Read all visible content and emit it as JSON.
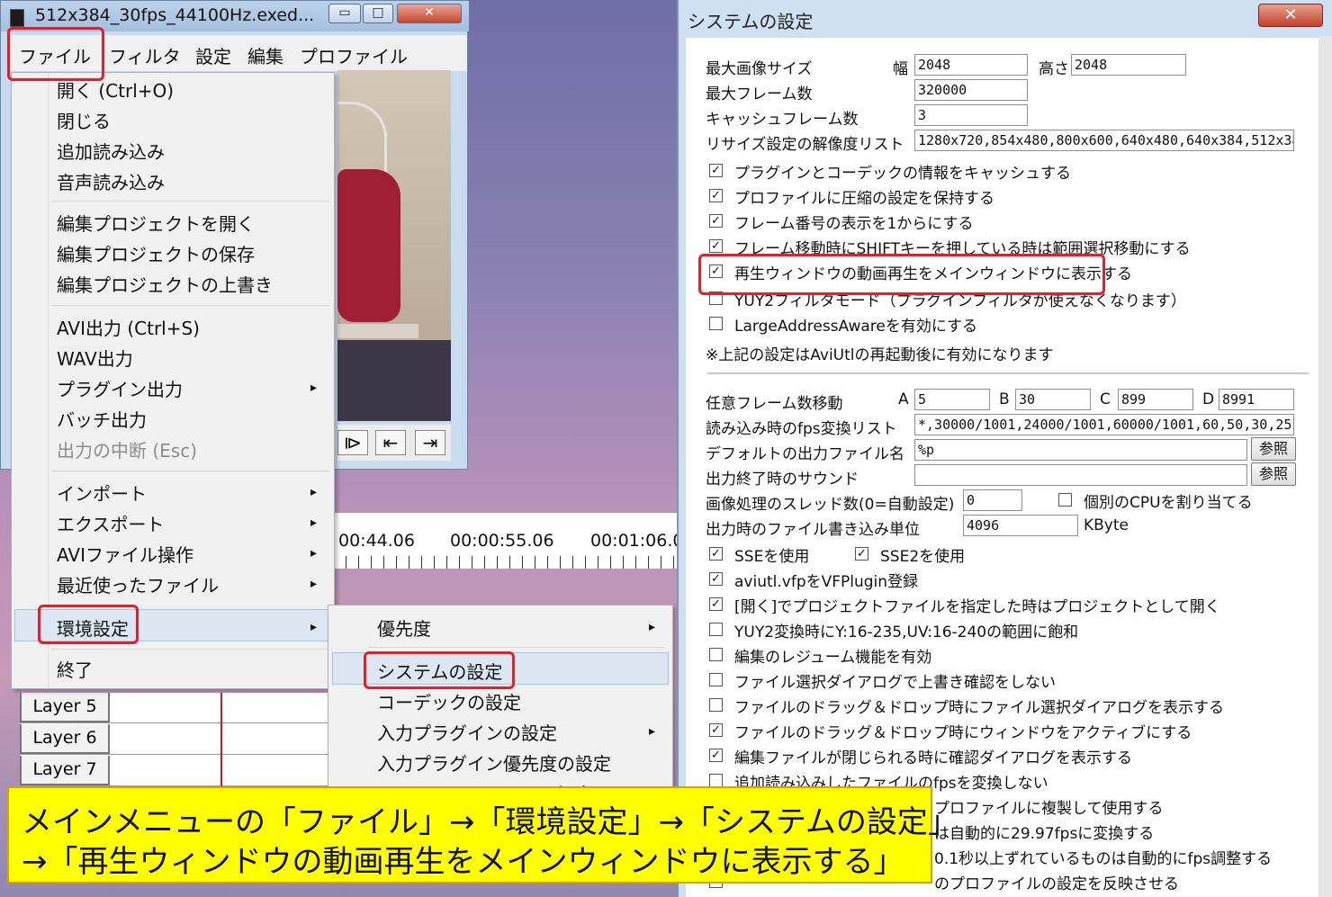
{
  "main_window": {
    "title": "512x384_30fps_44100Hz.exed...",
    "buttons": {
      "minimize": "▭",
      "maximize": "□",
      "close": "✕"
    },
    "menubar": [
      "ファイル",
      "フィルタ",
      "設定",
      "編集",
      "プロファイル"
    ],
    "transport": [
      "⧐",
      "⇤",
      "⇥"
    ],
    "timeline": {
      "times": [
        "00:44.06",
        "00:00:55.06",
        "00:01:06.0"
      ]
    },
    "layers": [
      "Layer  5",
      "Layer  6",
      "Layer  7"
    ]
  },
  "file_menu": {
    "items": [
      {
        "label": "開く (Ctrl+O)"
      },
      {
        "label": "閉じる"
      },
      {
        "label": "追加読み込み"
      },
      {
        "label": "音声読み込み"
      },
      {
        "label": "編集プロジェクトを開く"
      },
      {
        "label": "編集プロジェクトの保存"
      },
      {
        "label": "編集プロジェクトの上書き"
      },
      {
        "label": "AVI出力 (Ctrl+S)"
      },
      {
        "label": "WAV出力"
      },
      {
        "label": "プラグイン出力",
        "submenu": true
      },
      {
        "label": "バッチ出力"
      },
      {
        "label": "出力の中断 (Esc)",
        "disabled": true
      },
      {
        "label": "インポート",
        "submenu": true
      },
      {
        "label": "エクスポート",
        "submenu": true
      },
      {
        "label": "AVIファイル操作",
        "submenu": true
      },
      {
        "label": "最近使ったファイル",
        "submenu": true
      },
      {
        "label": "環境設定",
        "submenu": true,
        "highlighted": true
      },
      {
        "label": "終了"
      }
    ],
    "arrow_glyph": "▸"
  },
  "env_submenu": {
    "items": [
      {
        "label": "優先度",
        "submenu": true
      },
      {
        "label": "システムの設定",
        "highlighted": true
      },
      {
        "label": "コーデックの設定"
      },
      {
        "label": "入力プラグインの設定",
        "submenu": true
      },
      {
        "label": "入力プラグイン優先度の設定"
      },
      {
        "label": "ショートカットキーの設定"
      }
    ]
  },
  "dialog": {
    "title": "システムの設定",
    "close": "✕",
    "max_image_size": {
      "label": "最大画像サイズ",
      "width_label": "幅",
      "width": "2048",
      "height_label": "高さ",
      "height": "2048"
    },
    "max_frames": {
      "label": "最大フレーム数",
      "value": "320000"
    },
    "cache_frames": {
      "label": "キャッシュフレーム数",
      "value": "3"
    },
    "resize_list": {
      "label": "リサイズ設定の解像度リスト",
      "value": "1280x720,854x480,800x600,640x480,640x384,512x384"
    },
    "checks_top": [
      {
        "label": "プラグインとコーデックの情報をキャッシュする",
        "checked": true
      },
      {
        "label": "プロファイルに圧縮の設定を保持する",
        "checked": true
      },
      {
        "label": "フレーム番号の表示を1からにする",
        "checked": true
      },
      {
        "label": "フレーム移動時にSHIFTキーを押している時は範囲選択移動にする",
        "checked": true
      },
      {
        "label": "再生ウィンドウの動画再生をメインウィンドウに表示する",
        "checked": true
      },
      {
        "label": "YUY2フィルタモード（プラグインフィルタが使えなくなります）",
        "checked": false
      },
      {
        "label": "LargeAddressAwareを有効にする",
        "checked": false
      }
    ],
    "restart_note": "※上記の設定はAviUtlの再起動後に有効になります",
    "frame_jump": {
      "label": "任意フレーム数移動",
      "A": "5",
      "B": "30",
      "C": "899",
      "D": "8991"
    },
    "fps_list": {
      "label": "読み込み時のfps変換リスト",
      "value": "*,30000/1001,24000/1001,60000/1001,60,50,30,25,24,:"
    },
    "default_output": {
      "label": "デフォルトの出力ファイル名",
      "value": "%p",
      "ref": "参照"
    },
    "output_sound": {
      "label": "出力終了時のサウンド",
      "value": "",
      "ref": "参照"
    },
    "threads": {
      "label": "画像処理のスレッド数(0=自動設定)",
      "value": "0",
      "cpu_label": "個別のCPUを割り当てる"
    },
    "write_unit": {
      "label": "出力時のファイル書き込み単位",
      "value": "4096",
      "unit": "KByte"
    },
    "sse": {
      "label": "SSEを使用",
      "sse2": "SSE2を使用"
    },
    "checks_bottom": [
      {
        "label": "aviutl.vfpをVFPlugin登録",
        "checked": true
      },
      {
        "label": "[開く]でプロジェクトファイルを指定した時はプロジェクトとして開く",
        "checked": true
      },
      {
        "label": "YUY2変換時にY:16-235,UV:16-240の範囲に飽和",
        "checked": false
      },
      {
        "label": "編集のレジューム機能を有効",
        "checked": false
      },
      {
        "label": "ファイル選択ダイアログで上書き確認をしない",
        "checked": false
      },
      {
        "label": "ファイルのドラッグ＆ドロップ時にファイル選択ダイアログを表示する",
        "checked": false
      },
      {
        "label": "ファイルのドラッグ＆ドロップ時にウィンドウをアクティブにする",
        "checked": true
      },
      {
        "label": "編集ファイルが閉じられる時に確認ダイアログを表示する",
        "checked": true
      },
      {
        "label": "追加読み込みしたファイルのfpsを変換しない",
        "checked": false
      },
      {
        "label": "プロファイルに複製して使用する",
        "checked": false
      },
      {
        "label": "は自動的に29.97fpsに変換する",
        "checked": false
      },
      {
        "label": "0.1秒以上ずれているものは自動的にfps調整する",
        "checked": false
      },
      {
        "label": "のプロファイルの設定を反映させる",
        "checked": false
      }
    ]
  },
  "caption": {
    "line1": "メインメニューの「ファイル」→「環境設定」→「システムの設定」",
    "line2": "→「再生ウィンドウの動画再生をメインウィンドウに表示する」"
  },
  "colors": {
    "highlight_red": "#e0202a",
    "caption_yellow": "#ffff00"
  }
}
